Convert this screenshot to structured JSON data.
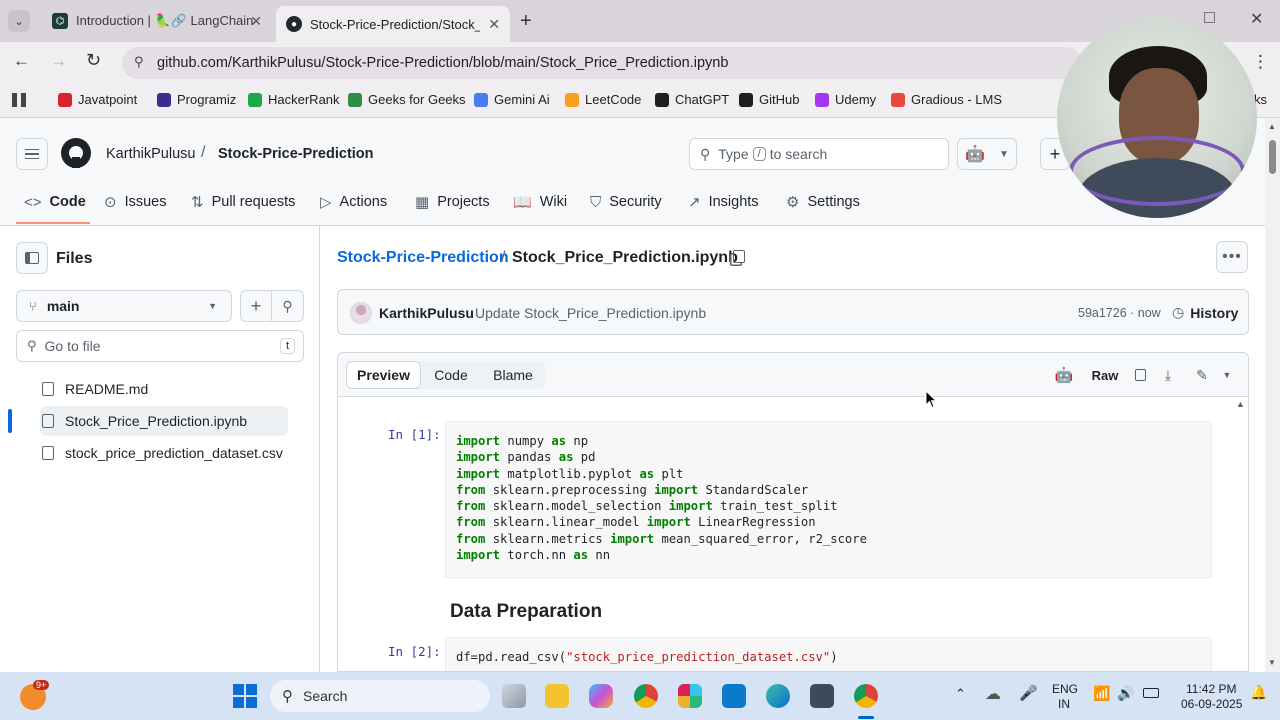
{
  "browser": {
    "tabs": [
      {
        "label": "Introduction | 🦜🔗 LangChain"
      },
      {
        "label": "Stock-Price-Prediction/Stock_P"
      }
    ],
    "url": "github.com/KarthikPulusu/Stock-Price-Prediction/blob/main/Stock_Price_Prediction.ipynb",
    "bookmarks": [
      {
        "label": "Javatpoint",
        "color": "#d9232e"
      },
      {
        "label": "Programiz",
        "color": "#3b2d8f"
      },
      {
        "label": "HackerRank",
        "color": "#1ba94c"
      },
      {
        "label": "Geeks for Geeks",
        "color": "#2f8d46"
      },
      {
        "label": "Gemini Ai",
        "color": "#4a7cf0"
      },
      {
        "label": "LeetCode",
        "color": "#f89f1b"
      },
      {
        "label": "ChatGPT",
        "color": "#1f1f1f"
      },
      {
        "label": "GitHub",
        "color": "#1f1f1f"
      },
      {
        "label": "Udemy",
        "color": "#a435f0"
      },
      {
        "label": "Gradious - LMS",
        "color": "#e9483f"
      }
    ],
    "bookmarks_overflow": "ks"
  },
  "repo": {
    "owner": "KarthikPulusu",
    "separator": "/",
    "name": "Stock-Price-Prediction",
    "search_prefix": "Type",
    "search_key": "/",
    "search_suffix": "to search"
  },
  "nav": [
    {
      "label": "Code",
      "icon": "<>"
    },
    {
      "label": "Issues",
      "icon": "⊙"
    },
    {
      "label": "Pull requests",
      "icon": "⇅"
    },
    {
      "label": "Actions",
      "icon": "▷"
    },
    {
      "label": "Projects",
      "icon": "▦"
    },
    {
      "label": "Wiki",
      "icon": "📖"
    },
    {
      "label": "Security",
      "icon": "⛉"
    },
    {
      "label": "Insights",
      "icon": "↗"
    },
    {
      "label": "Settings",
      "icon": "⚙"
    }
  ],
  "sidebar": {
    "title": "Files",
    "branch": "main",
    "goto_placeholder": "Go to file",
    "goto_key": "t",
    "files": [
      "README.md",
      "Stock_Price_Prediction.ipynb",
      "stock_price_prediction_dataset.csv"
    ]
  },
  "file": {
    "repo_link": "Stock-Price-Prediction",
    "sep": "/",
    "name": "Stock_Price_Prediction.ipynb",
    "commit_author": "KarthikPulusu",
    "commit_msg": "Update Stock_Price_Prediction.ipynb",
    "commit_meta": "59a1726 · now",
    "history": "History",
    "view_tabs": [
      "Preview",
      "Code",
      "Blame"
    ],
    "raw": "Raw"
  },
  "notebook": {
    "cell1_prompt": "In [1]:",
    "cell1_lines": [
      [
        [
          "kw",
          "import"
        ],
        [
          "t",
          " numpy "
        ],
        [
          "kw",
          "as"
        ],
        [
          "t",
          " np"
        ]
      ],
      [
        [
          "kw",
          "import"
        ],
        [
          "t",
          " pandas "
        ],
        [
          "kw",
          "as"
        ],
        [
          "t",
          " pd"
        ]
      ],
      [
        [
          "kw",
          "import"
        ],
        [
          "t",
          " matplotlib.pyplot "
        ],
        [
          "kw",
          "as"
        ],
        [
          "t",
          " plt"
        ]
      ],
      [
        [
          "kw",
          "from"
        ],
        [
          "t",
          " sklearn.preprocessing "
        ],
        [
          "kw",
          "import"
        ],
        [
          "t",
          " StandardScaler"
        ]
      ],
      [
        [
          "kw",
          "from"
        ],
        [
          "t",
          " sklearn.model_selection "
        ],
        [
          "kw",
          "import"
        ],
        [
          "t",
          " train_test_split"
        ]
      ],
      [
        [
          "kw",
          "from"
        ],
        [
          "t",
          " sklearn.linear_model "
        ],
        [
          "kw",
          "import"
        ],
        [
          "t",
          " LinearRegression"
        ]
      ],
      [
        [
          "kw",
          "from"
        ],
        [
          "t",
          " sklearn.metrics "
        ],
        [
          "kw",
          "import"
        ],
        [
          "t",
          " mean_squared_error, r2_score"
        ]
      ],
      [
        [
          "kw",
          "import"
        ],
        [
          "t",
          " torch.nn "
        ],
        [
          "kw",
          "as"
        ],
        [
          "t",
          " nn"
        ]
      ]
    ],
    "heading": "Data Preparation",
    "cell2_prompt": "In [2]:",
    "cell2_lines": [
      [
        [
          "t",
          "df=pd.read_csv("
        ],
        [
          "str",
          "\"stock_price_prediction_dataset.csv\""
        ],
        [
          "t",
          ")"
        ]
      ]
    ]
  },
  "taskbar": {
    "search": "Search",
    "lang1": "ENG",
    "lang2": "IN",
    "time": "11:42 PM",
    "date": "06-09-2025",
    "badge": "9+"
  }
}
